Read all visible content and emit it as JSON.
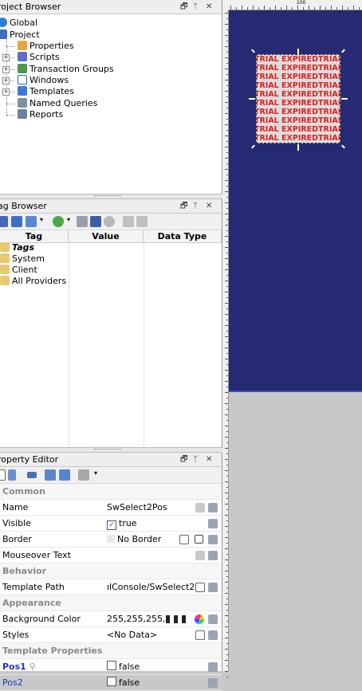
{
  "project_browser": {
    "title": "roject Browser",
    "items": [
      {
        "label": "Global",
        "icon": "globe-icon"
      },
      {
        "label": "Project",
        "icon": "project-icon"
      },
      {
        "label": "Properties",
        "icon": "properties-icon"
      },
      {
        "label": "Scripts",
        "icon": "scripts-icon"
      },
      {
        "label": "Transaction Groups",
        "icon": "transaction-groups-icon"
      },
      {
        "label": "Windows",
        "icon": "windows-icon"
      },
      {
        "label": "Templates",
        "icon": "templates-icon"
      },
      {
        "label": "Named Queries",
        "icon": "named-queries-icon"
      },
      {
        "label": "Reports",
        "icon": "reports-icon"
      }
    ]
  },
  "tag_browser": {
    "title": "ag Browser",
    "columns": [
      "Tag",
      "Value",
      "Data Type"
    ],
    "items": [
      {
        "label": "Tags",
        "icon": "folder-icon"
      },
      {
        "label": "System",
        "icon": "folder-icon"
      },
      {
        "label": "Client",
        "icon": "folder-icon"
      },
      {
        "label": "All Providers",
        "icon": "folder-icon"
      }
    ]
  },
  "property_editor": {
    "title": "roperty Editor",
    "rows": [
      {
        "type": "category",
        "name": "Common"
      },
      {
        "type": "prop",
        "name": "Name",
        "value": "SwSelect2Pos"
      },
      {
        "type": "prop",
        "name": "Visible",
        "value": "true",
        "checked": true
      },
      {
        "type": "prop",
        "name": "Border",
        "value": "No Border"
      },
      {
        "type": "prop",
        "name": "Mouseover Text",
        "value": ""
      },
      {
        "type": "category",
        "name": "Behavior"
      },
      {
        "type": "prop",
        "name": "Template Path",
        "value": "ılConsole/SwSelect2Pos"
      },
      {
        "type": "category",
        "name": "Appearance"
      },
      {
        "type": "prop",
        "name": "Background Color",
        "value": "255,255,255,0"
      },
      {
        "type": "prop",
        "name": "Styles",
        "value": "<No Data>"
      },
      {
        "type": "category",
        "name": "Template Properties"
      },
      {
        "type": "prop",
        "name": "Pos1",
        "value": "false",
        "checked": false
      },
      {
        "type": "prop",
        "name": "Pos2",
        "value": "false",
        "checked": false
      }
    ]
  },
  "window_controls": {
    "float": "🗗",
    "pin": "ᛘ",
    "close": "✕"
  },
  "designer": {
    "ruler_mark": "100",
    "watermark_line": "TRIAL EXPIREDTRIAL EX",
    "canvas_color": "#262a72",
    "watermark_color": "#e02020"
  }
}
